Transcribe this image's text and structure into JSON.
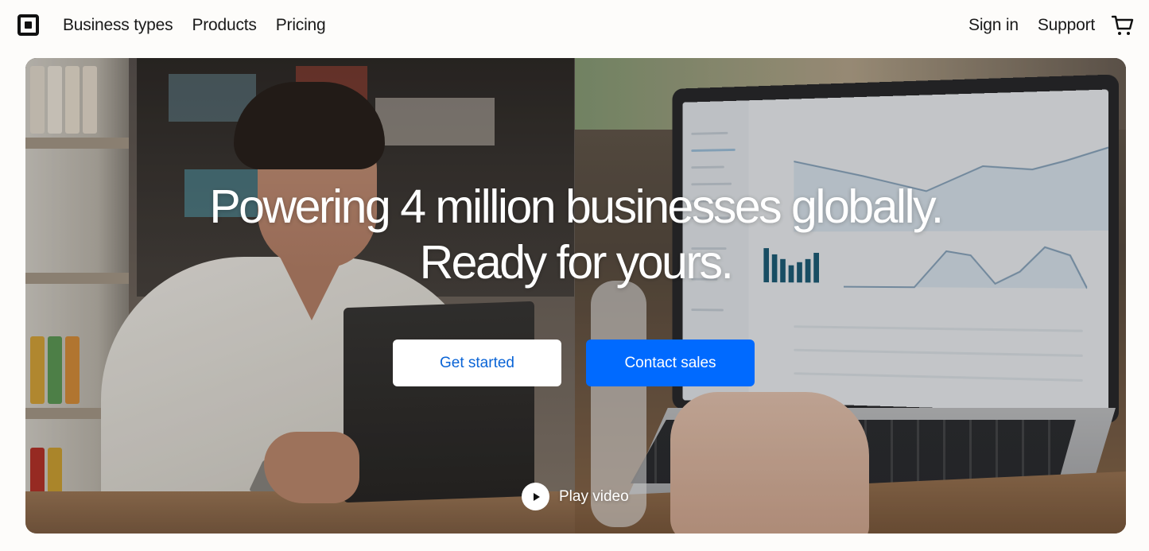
{
  "nav": {
    "left_links": [
      "Business types",
      "Products",
      "Pricing"
    ],
    "sign_in": "Sign in",
    "support": "Support",
    "cart_icon": "cart-icon",
    "logo_icon": "square-logo-icon"
  },
  "hero": {
    "headline_line1": "Powering 4 million businesses globally.",
    "headline_line2": "Ready for yours.",
    "primary_button": "Get started",
    "secondary_button": "Contact sales",
    "play_label": "Play video",
    "play_icon": "play-icon"
  },
  "colors": {
    "background": "#fdfcfa",
    "primary_blue": "#006aff",
    "get_started_text": "#0a64d6",
    "text_dark": "#1a1a1a"
  }
}
